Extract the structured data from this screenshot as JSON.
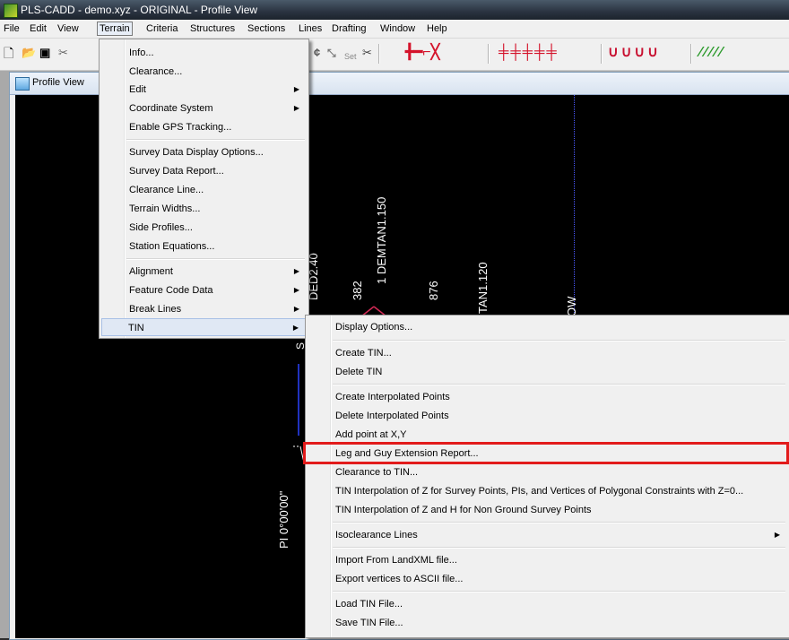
{
  "window": {
    "title": "PLS-CADD - demo.xyz - ORIGINAL - Profile View"
  },
  "menubar": [
    "File",
    "Edit",
    "View",
    "Terrain",
    "Criteria",
    "Structures",
    "Sections",
    "Lines",
    "Drafting",
    "Window",
    "Help"
  ],
  "toolbar": {
    "left": [
      "new-icon",
      "open-icon",
      "save-icon",
      "cut-icon"
    ],
    "set_label": "Set",
    "groups": [
      "┼─⌐╳",
      "╪╪╪╪╪",
      "∪∪∪∪",
      "⁄⁄⁄⁄⁄"
    ]
  },
  "profile_window": {
    "title": "Profile View"
  },
  "canvas": {
    "labels": [
      "DED2.40",
      "382",
      "1 DEMTAN1.150",
      "876",
      "TAN1.120",
      "OW",
      "PI 0°00'00\"",
      "S"
    ]
  },
  "terrain_menu": {
    "items": [
      {
        "label": "Info...",
        "submenu": false
      },
      {
        "label": "Clearance...",
        "submenu": false
      },
      {
        "label": "Edit",
        "submenu": true
      },
      {
        "label": "Coordinate System",
        "submenu": true
      },
      {
        "label": "Enable GPS Tracking...",
        "submenu": false
      },
      {
        "label": "Survey Data Display Options...",
        "submenu": false
      },
      {
        "label": "Survey Data Report...",
        "submenu": false
      },
      {
        "label": "Clearance Line...",
        "submenu": false
      },
      {
        "label": "Terrain Widths...",
        "submenu": false
      },
      {
        "label": "Side Profiles...",
        "submenu": false
      },
      {
        "label": "Station Equations...",
        "submenu": false
      },
      {
        "label": "Alignment",
        "submenu": true
      },
      {
        "label": "Feature Code Data",
        "submenu": true
      },
      {
        "label": "Break Lines",
        "submenu": true
      },
      {
        "label": "TIN",
        "submenu": true
      }
    ],
    "active_item": "TIN"
  },
  "tin_menu": {
    "items": [
      {
        "label": "Display Options...",
        "submenu": false
      },
      {
        "label": "Create TIN...",
        "submenu": false
      },
      {
        "label": "Delete TIN",
        "submenu": false
      },
      {
        "label": "Create Interpolated Points",
        "submenu": false
      },
      {
        "label": "Delete Interpolated Points",
        "submenu": false
      },
      {
        "label": "Add point at X,Y",
        "submenu": false
      },
      {
        "label": "Leg and Guy Extension Report...",
        "submenu": false
      },
      {
        "label": "Clearance to TIN...",
        "submenu": false
      },
      {
        "label": "TIN Interpolation of Z for Survey Points, PIs, and Vertices of Polygonal Constraints with Z=0...",
        "submenu": false
      },
      {
        "label": "TIN Interpolation of Z and H for Non Ground Survey Points",
        "submenu": false
      },
      {
        "label": "Isoclearance Lines",
        "submenu": true
      },
      {
        "label": "Import From LandXML file...",
        "submenu": false
      },
      {
        "label": "Export vertices to ASCII file...",
        "submenu": false
      },
      {
        "label": "Load TIN File...",
        "submenu": false
      },
      {
        "label": "Save TIN File...",
        "submenu": false
      }
    ],
    "highlighted_item": "Leg and Guy Extension Report..."
  },
  "colors": {
    "highlight_box": "#e21b1b",
    "canvas_bg": "#000000",
    "guide_line": "#4a58ff"
  }
}
